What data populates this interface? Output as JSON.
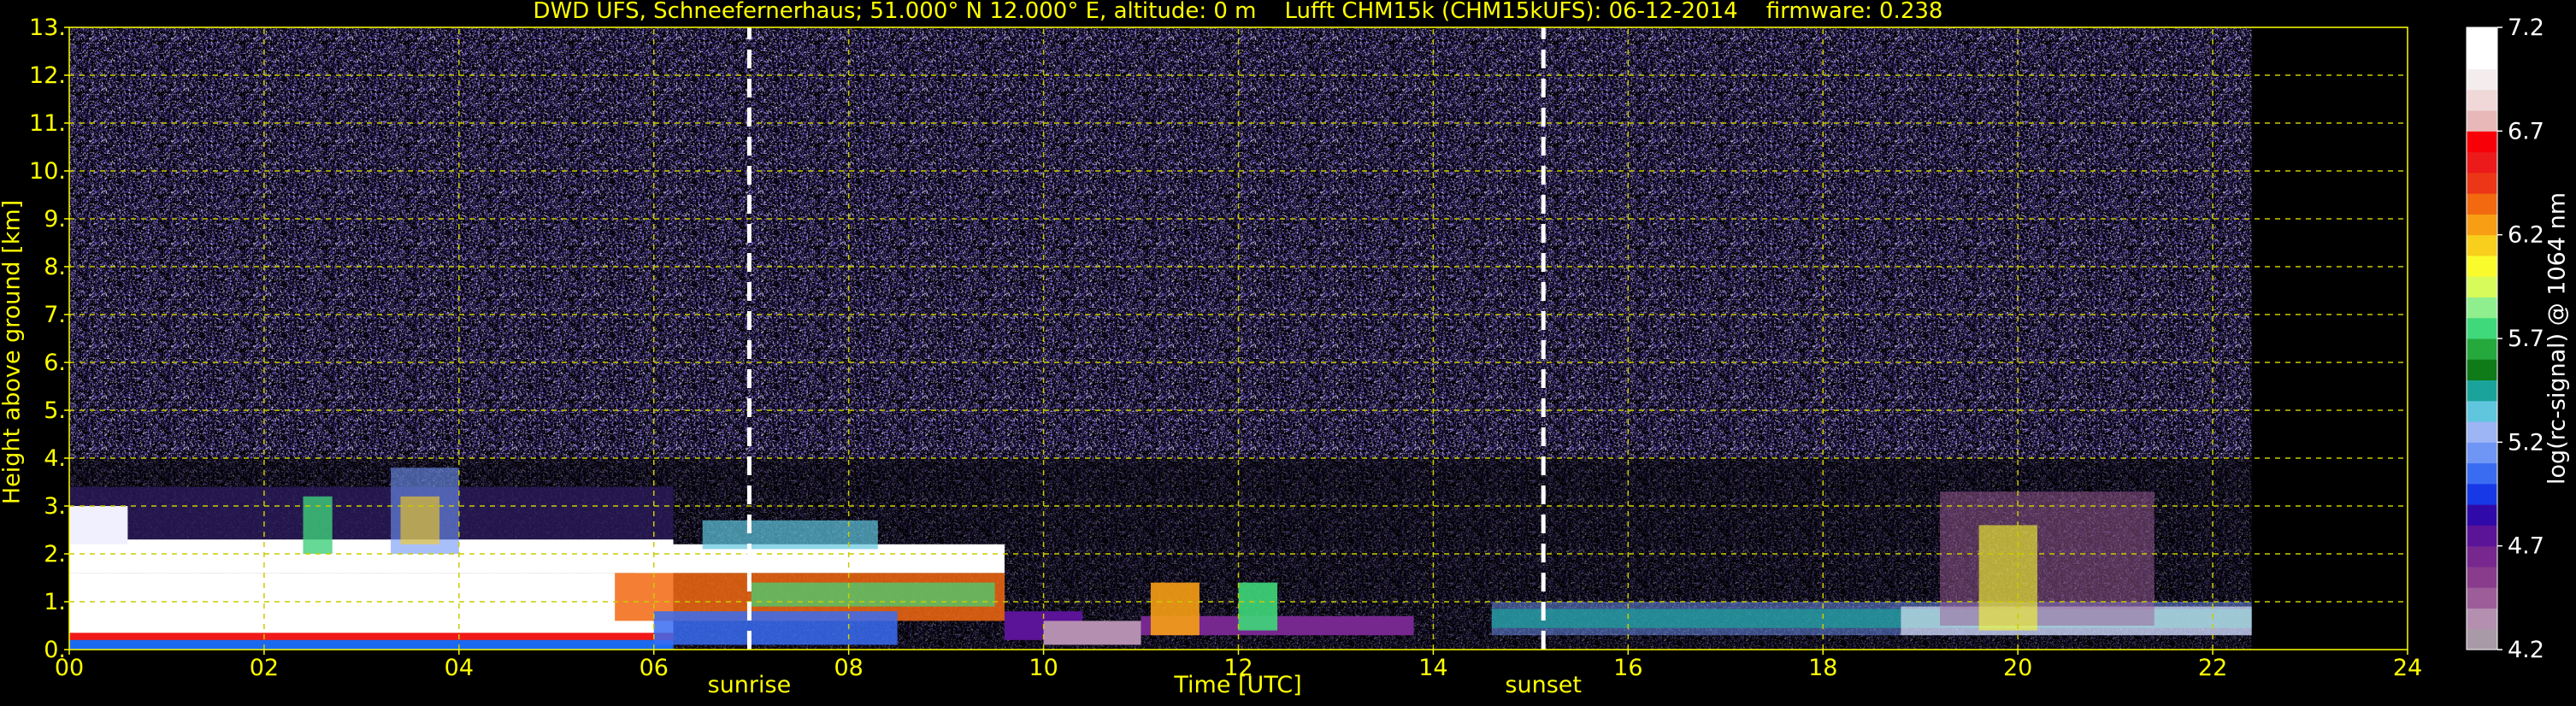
{
  "chart_data": {
    "type": "heatmap",
    "title": "DWD UFS, Schneefernerhaus; 51.000° N 12.000° E, altitude: 0 m    Lufft CHM15k (CHM15kUFS): 06-12-2014    firmware: 0.238",
    "xlabel": "Time [UTC]",
    "ylabel": "Height above ground [km]",
    "xlim": [
      0,
      24
    ],
    "ylim": [
      0,
      13
    ],
    "x_ticks": [
      "00",
      "02",
      "04",
      "06",
      "08",
      "10",
      "12",
      "14",
      "16",
      "18",
      "20",
      "22",
      "24"
    ],
    "y_ticks": [
      "0.",
      "1.",
      "2.",
      "3.",
      "4.",
      "5.",
      "6.",
      "7.",
      "8.",
      "9.",
      "10.",
      "11.",
      "12.",
      "13."
    ],
    "grid": true,
    "data_end_time": 22.4,
    "markers": [
      {
        "label": "sunrise",
        "time": 6.98
      },
      {
        "label": "sunset",
        "time": 15.13
      }
    ],
    "colorbar": {
      "label": "log(rc-signal) @ 1064 nm",
      "range": [
        4.2,
        7.2
      ],
      "ticks": [
        "4.2",
        "4.7",
        "5.2",
        "5.7",
        "6.2",
        "6.7",
        "7.2"
      ],
      "colors": [
        "#a89aa6",
        "#b48fb0",
        "#9d5d98",
        "#8a3c8c",
        "#76288f",
        "#5b1398",
        "#300aa8",
        "#1638e6",
        "#3a6cf2",
        "#6f95f5",
        "#9db5f5",
        "#60c6de",
        "#1aa39a",
        "#0e7a18",
        "#25a83c",
        "#3fd87a",
        "#8fef8e",
        "#d6fb5a",
        "#fafb2c",
        "#f8cf1c",
        "#f79e14",
        "#f26910",
        "#ec3618",
        "#ec1a1a",
        "#f80008",
        "#e8b8b8",
        "#f0d8d8",
        "#f4eded",
        "#ffffff",
        "#ffffff"
      ]
    },
    "signal_structures": [
      {
        "type": "boundary layer",
        "t_start": 0.0,
        "t_end": 6.2,
        "h_base": 0.0,
        "h_top": 2.2
      },
      {
        "type": "aerosol layer",
        "t_start": 6.2,
        "t_end": 9.6,
        "h_base": 0.0,
        "h_top": 2.1
      },
      {
        "type": "low layer",
        "t_start": 9.6,
        "t_end": 13.8,
        "h_base": 0.2,
        "h_top": 0.9
      },
      {
        "type": "low layer",
        "t_start": 14.6,
        "t_end": 22.4,
        "h_base": 0.3,
        "h_top": 1.0
      },
      {
        "type": "plumes",
        "t_start": 19.0,
        "t_end": 21.4,
        "h_base": 0.4,
        "h_top": 3.3
      }
    ]
  }
}
